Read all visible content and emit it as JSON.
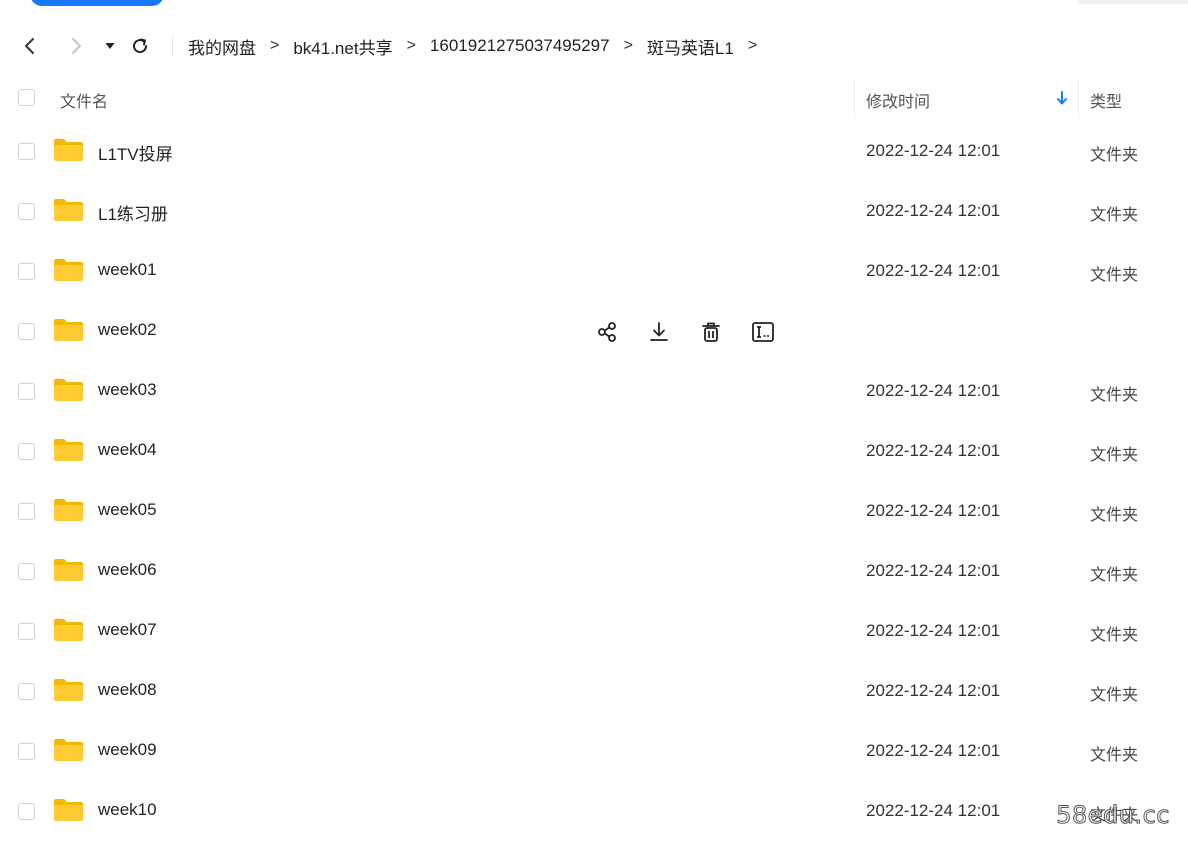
{
  "nav": {
    "breadcrumbs": [
      "我的网盘",
      "bk41.net共享",
      "1601921275037495297",
      "斑马英语L1"
    ],
    "separator": ">"
  },
  "header": {
    "name_label": "文件名",
    "time_label": "修改时间",
    "type_label": "类型"
  },
  "files": [
    {
      "name": "L1TV投屏",
      "time": "2022-12-24 12:01",
      "type": "文件夹"
    },
    {
      "name": "L1练习册",
      "time": "2022-12-24 12:01",
      "type": "文件夹"
    },
    {
      "name": "week01",
      "time": "2022-12-24 12:01",
      "type": "文件夹"
    },
    {
      "name": "week02",
      "time": "",
      "type": ""
    },
    {
      "name": "week03",
      "time": "2022-12-24 12:01",
      "type": "文件夹"
    },
    {
      "name": "week04",
      "time": "2022-12-24 12:01",
      "type": "文件夹"
    },
    {
      "name": "week05",
      "time": "2022-12-24 12:01",
      "type": "文件夹"
    },
    {
      "name": "week06",
      "time": "2022-12-24 12:01",
      "type": "文件夹"
    },
    {
      "name": "week07",
      "time": "2022-12-24 12:01",
      "type": "文件夹"
    },
    {
      "name": "week08",
      "time": "2022-12-24 12:01",
      "type": "文件夹"
    },
    {
      "name": "week09",
      "time": "2022-12-24 12:01",
      "type": "文件夹"
    },
    {
      "name": "week10",
      "time": "2022-12-24 12:01",
      "type": "文件夹"
    }
  ],
  "hover_actions": [
    "share-icon",
    "download-icon",
    "delete-icon",
    "rename-icon"
  ],
  "watermark": "58edu.cc",
  "colors": {
    "accent": "#1677ff",
    "folder": "#ffcc33",
    "folder_tab": "#f5b800"
  }
}
